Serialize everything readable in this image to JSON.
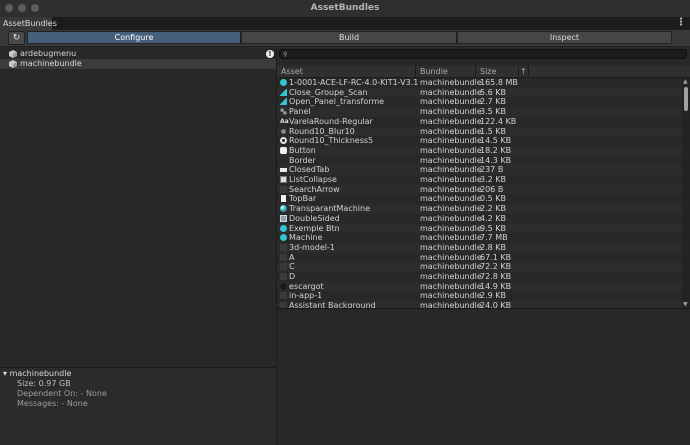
{
  "window": {
    "title": "AssetBundles"
  },
  "tab": {
    "label": "AssetBundles",
    "menu_icon": "⋮"
  },
  "toolbar": {
    "refresh_icon": "↻",
    "modes": [
      "Configure",
      "Build",
      "Inspect"
    ],
    "active_mode": "Configure"
  },
  "bundles": [
    {
      "name": "ardebugmenu",
      "warning": "!"
    },
    {
      "name": "machinebundle"
    }
  ],
  "details": {
    "title": "machinebundle",
    "size": "Size: 0.97 GB",
    "dependent": "Dependent On: - None",
    "messages": "Messages: - None"
  },
  "search": {
    "icon": "🔍",
    "value": ""
  },
  "table": {
    "headers": [
      "Asset",
      "Bundle",
      "Size",
      "↑"
    ],
    "rows": [
      {
        "icon": "cyan-model-icon",
        "name": "1-0001-ACE-LF-RC-4.0-KIT1-V3.1",
        "bundle": "machinebundle",
        "size": "165.8 MB"
      },
      {
        "icon": "mesh-icon",
        "name": "Close_Groupe_Scan",
        "bundle": "machinebundle",
        "size": "5.6 KB"
      },
      {
        "icon": "mesh-icon",
        "name": "Open_Panel_transforme",
        "bundle": "machinebundle",
        "size": "2.7 KB"
      },
      {
        "icon": "prefab-multi-icon",
        "name": "Panel",
        "bundle": "machinebundle",
        "size": "3.5 KB"
      },
      {
        "icon": "font-icon",
        "name": "VarelaRound-Regular",
        "bundle": "machinebundle",
        "size": "122.4 KB"
      },
      {
        "icon": "texture-icon",
        "name": "Round10_Blur10",
        "bundle": "machinebundle",
        "size": "1.5 KB"
      },
      {
        "icon": "ring-icon",
        "name": "Round10_Thickness5",
        "bundle": "machinebundle",
        "size": "14.5 KB"
      },
      {
        "icon": "white-square-icon",
        "name": "Button",
        "bundle": "machinebundle",
        "size": "18.2 KB"
      },
      {
        "icon": "empty-icon",
        "name": "Border",
        "bundle": "machinebundle",
        "size": "14.3 KB"
      },
      {
        "icon": "bar-icon",
        "name": "ClosedTab",
        "bundle": "machinebundle",
        "size": "237 B"
      },
      {
        "icon": "list-icon",
        "name": "ListCollapse",
        "bundle": "machinebundle",
        "size": "3.2 KB"
      },
      {
        "icon": "dark-icon",
        "name": "SearchArrow",
        "bundle": "machinebundle",
        "size": "206 B"
      },
      {
        "icon": "document-icon",
        "name": "TopBar",
        "bundle": "machinebundle",
        "size": "0.5 KB"
      },
      {
        "icon": "material-icon",
        "name": "TransparantMachine",
        "bundle": "machinebundle",
        "size": "2.2 KB"
      },
      {
        "icon": "shader-icon",
        "name": "DoubleSided",
        "bundle": "machinebundle",
        "size": "4.2 KB"
      },
      {
        "icon": "cyan-model-icon",
        "name": "Exemple Btn",
        "bundle": "machinebundle",
        "size": "9.5 KB"
      },
      {
        "icon": "cyan-model-icon",
        "name": "Machine",
        "bundle": "machinebundle",
        "size": "7.7 MB"
      },
      {
        "icon": "dark-icon",
        "name": "3d-model-1",
        "bundle": "machinebundle",
        "size": "2.8 KB"
      },
      {
        "icon": "dark-icon",
        "name": "A",
        "bundle": "machinebundle",
        "size": "67.1 KB"
      },
      {
        "icon": "dark-icon",
        "name": "C",
        "bundle": "machinebundle",
        "size": "72.2 KB"
      },
      {
        "icon": "dark-icon",
        "name": "D",
        "bundle": "machinebundle",
        "size": "72.8 KB"
      },
      {
        "icon": "dark-circle-icon",
        "name": "escargot",
        "bundle": "machinebundle",
        "size": "14.9 KB"
      },
      {
        "icon": "dark-icon",
        "name": "in-app-1",
        "bundle": "machinebundle",
        "size": "2.9 KB"
      },
      {
        "icon": "dark-icon",
        "name": "Assistant Background",
        "bundle": "machinebundle",
        "size": "24.0 KB"
      }
    ]
  },
  "colors": {
    "accent": "#46607c",
    "background": "#282828",
    "cyan": "#35c4d4"
  }
}
